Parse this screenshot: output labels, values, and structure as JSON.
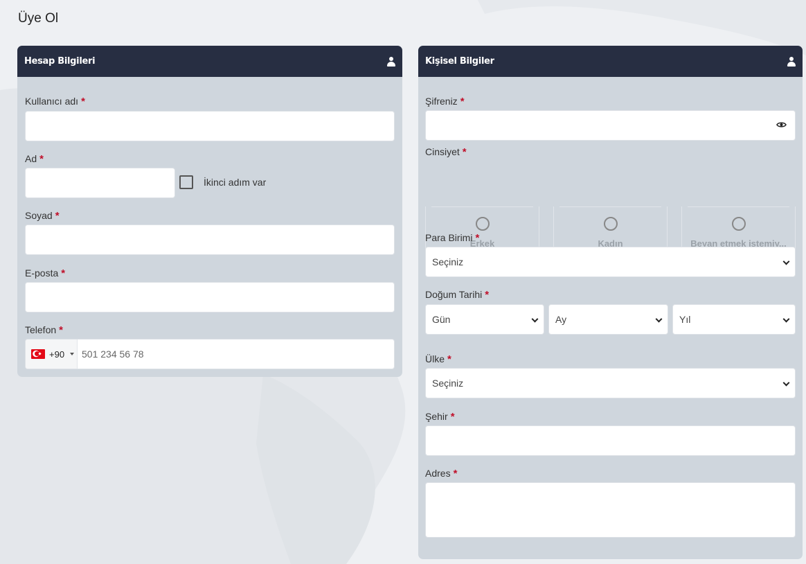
{
  "page": {
    "title": "Üye Ol"
  },
  "account_card": {
    "title": "Hesap Bilgileri",
    "icon": "user-icon",
    "fields": {
      "username": {
        "label": "Kullanıcı adı",
        "value": ""
      },
      "first_name": {
        "label": "Ad",
        "value": ""
      },
      "middle_name_checkbox": {
        "label": "İkinci adım var",
        "checked": false
      },
      "last_name": {
        "label": "Soyad",
        "value": ""
      },
      "email": {
        "label": "E-posta",
        "value": ""
      },
      "phone": {
        "label": "Telefon",
        "country_code": "+90",
        "placeholder": "501 234 56 78",
        "flag": "turkey-flag"
      }
    },
    "required_mark": "*"
  },
  "personal_card": {
    "title": "Kişisel Bilgiler",
    "icon": "user-icon",
    "fields": {
      "password": {
        "label": "Şifreniz",
        "value": ""
      },
      "gender": {
        "label": "Cinsiyet",
        "options": [
          "Erkek",
          "Kadın",
          "Beyan etmek istemiy..."
        ]
      },
      "currency": {
        "label": "Para Birimi",
        "selected": "Seçiniz"
      },
      "birth_date": {
        "label": "Doğum Tarihi",
        "day": "Gün",
        "month": "Ay",
        "year": "Yıl"
      },
      "country": {
        "label": "Ülke",
        "selected": "Seçiniz"
      },
      "city": {
        "label": "Şehir",
        "value": ""
      },
      "address": {
        "label": "Adres",
        "value": ""
      }
    },
    "required_mark": "*"
  },
  "colors": {
    "header_bg": "#272e42",
    "card_bg": "#cfd6dd",
    "required": "#c0102a",
    "page_bg": "#eef0f3"
  }
}
